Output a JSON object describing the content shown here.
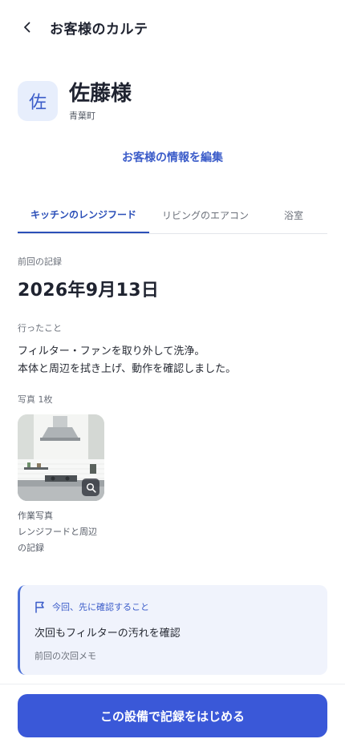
{
  "header": {
    "title": "お客様のカルテ",
    "back_icon": "chevron-left-icon"
  },
  "customer": {
    "avatar_initial": "佐",
    "name": "佐藤様",
    "area": "青葉町"
  },
  "edit_link": "お客様の情報を編集",
  "tabs": [
    {
      "label": "キッチンのレンジフード",
      "active": true
    },
    {
      "label": "リビングのエアコン",
      "active": false
    },
    {
      "label": "浴室",
      "active": false
    }
  ],
  "record": {
    "previous_label": "前回の記録",
    "previous_date": "2026年9月13日",
    "done_label": "行ったこと",
    "done_lines": [
      "フィルター・ファンを取り外して洗浄。",
      "本体と周辺を拭き上げ、動作を確認しました。"
    ],
    "photos_label": "写真 1枚",
    "photo_caption_lines": [
      "作業写真",
      "レンジフードと周辺",
      "の記録"
    ]
  },
  "note": {
    "heading": "今回、先に確認すること",
    "body": "次回もフィルターの汚れを確認",
    "footer": "前回の次回メモ",
    "icon": "flag-icon"
  },
  "cta": {
    "label": "この設備で記録をはじめる"
  },
  "colors": {
    "accent": "#3a58d8",
    "link": "#3b5cc9",
    "note_bg": "#f0f3fc"
  }
}
